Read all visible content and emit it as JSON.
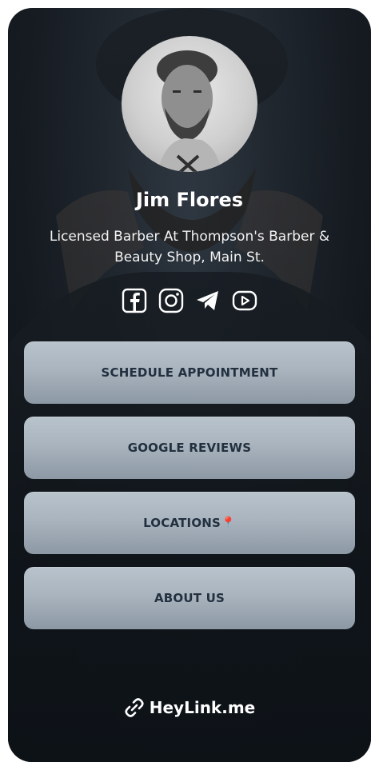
{
  "profile": {
    "name": "Jim Flores",
    "bio": "Licensed Barber At Thompson's Barber & Beauty Shop, Main St."
  },
  "socials": [
    {
      "icon": "facebook-icon"
    },
    {
      "icon": "instagram-icon"
    },
    {
      "icon": "telegram-icon"
    },
    {
      "icon": "youtube-icon"
    }
  ],
  "links": [
    {
      "label": "SCHEDULE APPOINTMENT"
    },
    {
      "label": "GOOGLE REVIEWS"
    },
    {
      "label": "LOCATIONS📍"
    },
    {
      "label": "ABOUT US"
    }
  ],
  "footer": {
    "brand": "HeyLink.me"
  },
  "colors": {
    "button_text": "#22303f",
    "button_bg": "#a9b4be",
    "background": "#161c22"
  }
}
